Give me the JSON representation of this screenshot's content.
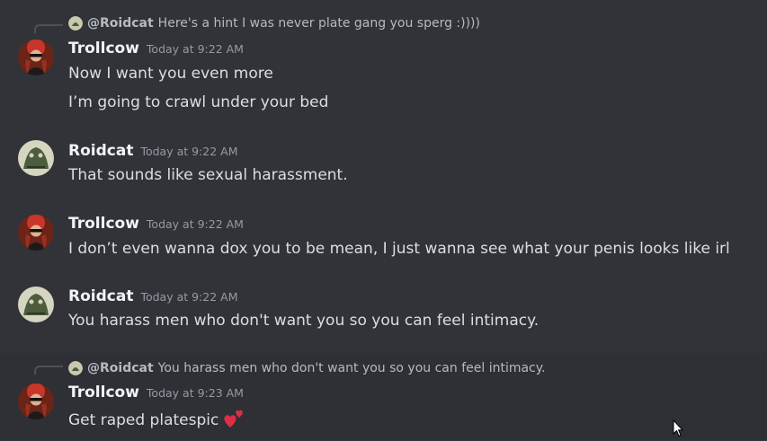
{
  "colors": {
    "background": "#313338",
    "highlight": "#2e3035",
    "text": "#dbdee1",
    "muted": "#949ba4",
    "author": "#f2f3f5"
  },
  "messages": [
    {
      "reply": {
        "author": "@Roidcat",
        "text": "Here's a hint I was never plate gang you sperg :))))"
      },
      "author": "Trollcow",
      "timestamp": "Today at 9:22 AM",
      "lines": [
        "Now I want you even more",
        "I’m going to crawl under your bed"
      ]
    },
    {
      "author": "Roidcat",
      "timestamp": "Today at 9:22 AM",
      "lines": [
        "That sounds like sexual harassment."
      ]
    },
    {
      "author": "Trollcow",
      "timestamp": "Today at 9:22 AM",
      "lines": [
        "I don’t even wanna dox you to be mean, I just wanna see what your penis looks like irl"
      ]
    },
    {
      "author": "Roidcat",
      "timestamp": "Today at 9:22 AM",
      "lines": [
        "You harass men who don't want you so you can feel intimacy."
      ]
    },
    {
      "reply": {
        "author": "@Roidcat",
        "text": "You harass men who don't want you so you can feel intimacy."
      },
      "author": "Trollcow",
      "timestamp": "Today at 9:23 AM",
      "lines": [
        "Get raped platespic"
      ],
      "emoji": "two-hearts-emoji"
    }
  ]
}
